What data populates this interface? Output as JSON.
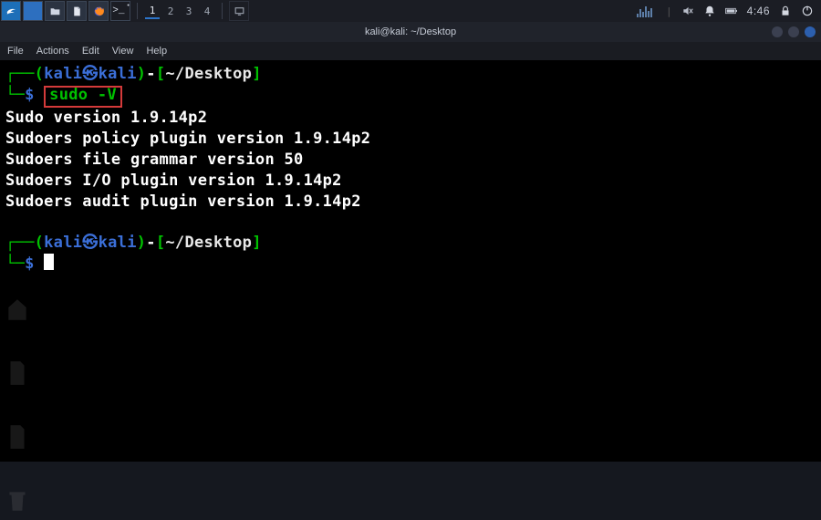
{
  "panel": {
    "workspaces": [
      "1",
      "2",
      "3",
      "4"
    ],
    "active_ws": "1",
    "clock": "4:46",
    "term_launcher_glyph": ">_"
  },
  "window": {
    "title": "kali@kali: ~/Desktop"
  },
  "menubar": {
    "file": "File",
    "actions": "Actions",
    "edit": "Edit",
    "view": "View",
    "help": "Help"
  },
  "terminal": {
    "p1_open": "┌──(",
    "p1_user": "kali",
    "p1_at": "㉿",
    "p1_host": "kali",
    "p1_close": ")",
    "p1_dash": "-",
    "p1_lb": "[",
    "p1_path": "~/Desktop",
    "p1_rb": "]",
    "p2_elbow": "└─",
    "p2_dollar": "$ ",
    "command": "sudo -V",
    "out1": "Sudo version 1.9.14p2",
    "out2": "Sudoers policy plugin version 1.9.14p2",
    "out3": "Sudoers file grammar version 50",
    "out4": "Sudoers I/O plugin version 1.9.14p2",
    "out5": "Sudoers audit plugin version 1.9.14p2"
  }
}
